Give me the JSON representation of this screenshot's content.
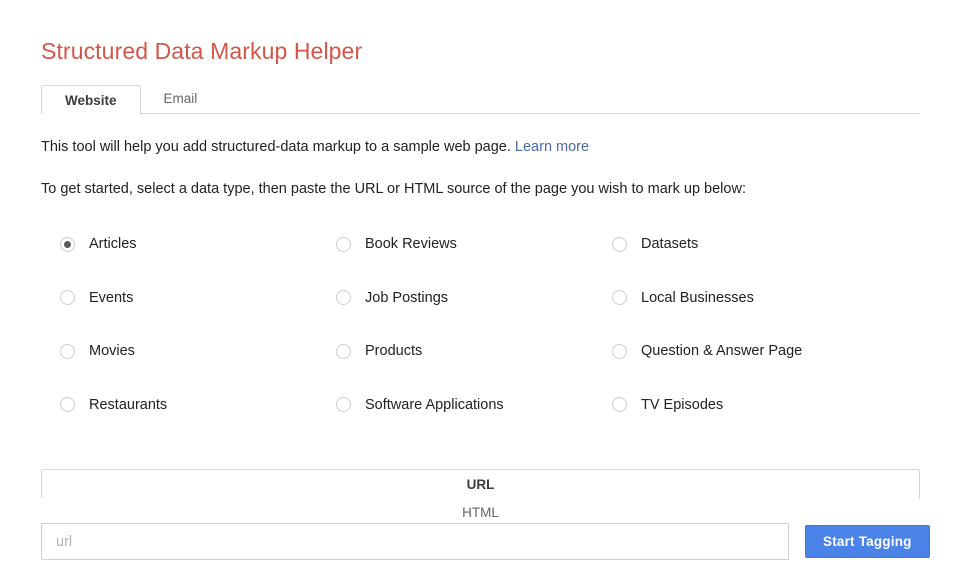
{
  "app": {
    "title": "Structured Data Markup Helper"
  },
  "main_tabs": {
    "items": [
      {
        "label": "Website",
        "active": true
      },
      {
        "label": "Email",
        "active": false
      }
    ]
  },
  "intro": {
    "text": "This tool will help you add structured-data markup to a sample web page.",
    "link_label": "Learn more"
  },
  "instructions": {
    "text": "To get started, select a data type, then paste the URL or HTML source of the page you wish to mark up below:"
  },
  "data_types": {
    "selected": "Articles",
    "items": [
      {
        "label": "Articles",
        "selected": true
      },
      {
        "label": "Book Reviews",
        "selected": false
      },
      {
        "label": "Datasets",
        "selected": false
      },
      {
        "label": "Events",
        "selected": false
      },
      {
        "label": "Job Postings",
        "selected": false
      },
      {
        "label": "Local Businesses",
        "selected": false
      },
      {
        "label": "Movies",
        "selected": false
      },
      {
        "label": "Products",
        "selected": false
      },
      {
        "label": "Question & Answer Page",
        "selected": false
      },
      {
        "label": "Restaurants",
        "selected": false
      },
      {
        "label": "Software Applications",
        "selected": false
      },
      {
        "label": "TV Episodes",
        "selected": false
      }
    ]
  },
  "source_tabs": {
    "items": [
      {
        "label": "URL",
        "active": true
      },
      {
        "label": "HTML",
        "active": false
      }
    ]
  },
  "source_input": {
    "value": "",
    "placeholder": "url"
  },
  "actions": {
    "start_tagging_label": "Start Tagging"
  },
  "colors": {
    "title": "#d4564a",
    "link": "#4a6aa5",
    "primary_button": "#4a82e8",
    "radio_selected": "#5b5b5b",
    "border": "#d6d6d6"
  }
}
